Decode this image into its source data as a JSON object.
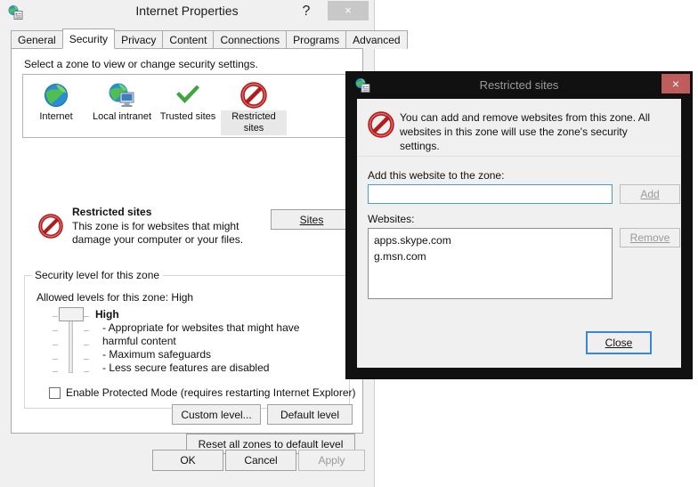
{
  "main_window": {
    "title": "Internet Properties",
    "app_icon": "internet-properties-icon",
    "help_label": "?",
    "close_label": "×",
    "tabs": [
      {
        "label": "General",
        "active": false
      },
      {
        "label": "Security",
        "active": true
      },
      {
        "label": "Privacy",
        "active": false
      },
      {
        "label": "Content",
        "active": false
      },
      {
        "label": "Connections",
        "active": false
      },
      {
        "label": "Programs",
        "active": false
      },
      {
        "label": "Advanced",
        "active": false
      }
    ],
    "security_tab": {
      "zone_prompt": "Select a zone to view or change security settings.",
      "zones": [
        {
          "label": "Internet",
          "icon": "globe-icon",
          "selected": false
        },
        {
          "label": "Local intranet",
          "icon": "globe-computer-icon",
          "selected": false
        },
        {
          "label": "Trusted sites",
          "icon": "green-check-icon",
          "selected": false
        },
        {
          "label": "Restricted sites",
          "icon": "red-prohibition-icon",
          "selected": true
        }
      ],
      "zone_description": {
        "icon": "red-prohibition-icon",
        "title": "Restricted sites",
        "text": "This zone is for websites that might damage your computer or your files."
      },
      "sites_button": "Sites",
      "security_level": {
        "group_title": "Security level for this zone",
        "allowed_levels": "Allowed levels for this zone: High",
        "level_name": "High",
        "bullets": [
          "- Appropriate for websites that might have harmful content",
          "- Maximum safeguards",
          "- Less secure features are disabled"
        ],
        "slider_position": "top",
        "slider_ticks": 5
      },
      "protected_mode": {
        "label": "Enable Protected Mode (requires restarting Internet Explorer)",
        "checked": false
      },
      "custom_level_button": "Custom level...",
      "default_level_button": "Default level",
      "reset_button": "Reset all zones to default level"
    },
    "footer": {
      "ok": "OK",
      "cancel": "Cancel",
      "apply": "Apply",
      "apply_disabled": true
    }
  },
  "restricted_sites_dialog": {
    "title": "Restricted sites",
    "app_icon": "internet-properties-icon",
    "close_label": "×",
    "info_icon": "red-prohibition-icon",
    "info_text": "You can add and remove websites from this zone. All websites in this zone will use the zone's security settings.",
    "add_label": "Add this website to the zone:",
    "add_input_value": "",
    "add_input_placeholder": "",
    "add_button": "Add",
    "add_button_disabled": true,
    "websites_label": "Websites:",
    "websites": [
      "apps.skype.com",
      "g.msn.com"
    ],
    "remove_button": "Remove",
    "remove_button_disabled": true,
    "close_button": "Close"
  },
  "colors": {
    "window_bg": "#f0f0f0",
    "dialog_frame": "#111111",
    "close_red": "#bf5c5c",
    "focus_blue": "#3a87d6",
    "danger_red": "#c02020",
    "check_green": "#3fa63f"
  }
}
